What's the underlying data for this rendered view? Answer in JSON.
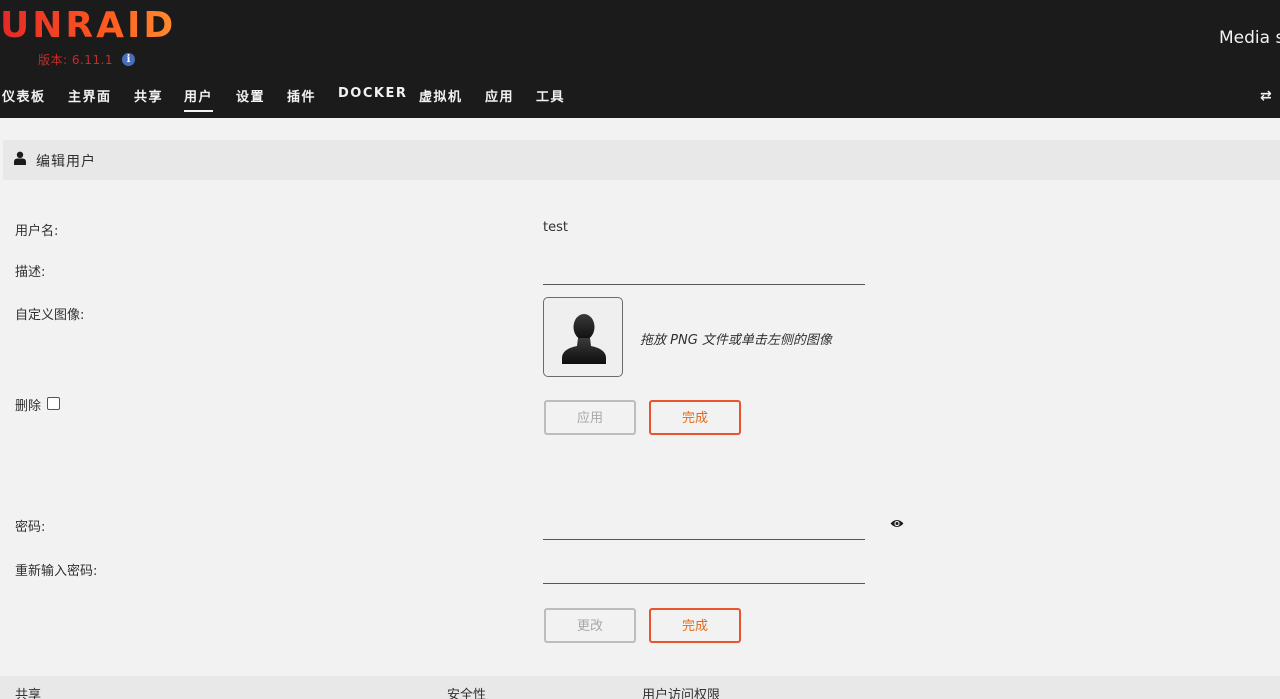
{
  "header": {
    "logo": "UNRAID",
    "version": "版本: 6.11.1",
    "info_icon": "i",
    "server_name": "Media s",
    "nav": [
      "仪表板",
      "主界面",
      "共享",
      "用户",
      "设置",
      "插件",
      "DOCKER",
      "虚拟机",
      "应用",
      "工具"
    ],
    "active_nav": "用户",
    "right_icon": "⇄"
  },
  "section": {
    "icon": "user-icon",
    "title": "编辑用户"
  },
  "form": {
    "username_label": "用户名:",
    "username_value": "test",
    "description_label": "描述:",
    "description_value": "",
    "custom_image_label": "自定义图像:",
    "drop_hint": "拖放 PNG 文件或单击左侧的图像",
    "delete_label": "删除",
    "apply_button": "应用",
    "done_button": "完成",
    "password_label": "密码:",
    "password_value": "",
    "retype_password_label": "重新输入密码:",
    "retype_password_value": "",
    "change_button": "更改",
    "done_button_2": "完成"
  },
  "table": {
    "headers": [
      "共享",
      "安全性",
      "用户访问权限"
    ]
  },
  "colors": {
    "header_bg": "#1c1b1b",
    "accent": "#e9542c",
    "page_bg": "#f2f2f2"
  }
}
